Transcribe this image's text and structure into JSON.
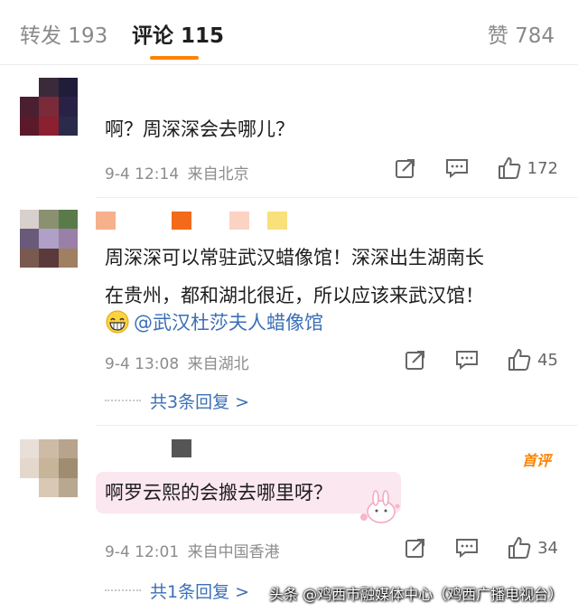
{
  "tabs": {
    "repost": "转发 193",
    "comment": "评论 115",
    "like": "赞 784"
  },
  "comments": [
    {
      "text": "啊？周深深会去哪儿？",
      "time": "9-4 12:14",
      "location": "来自北京",
      "likes": "172"
    },
    {
      "line1": "周深深可以常驻武汉蜡像馆！深深出生湖南长",
      "line2": "在贵州，都和湖北很近，所以应该来武汉馆！",
      "mention": "@武汉杜莎夫人蜡像馆",
      "time": "9-4 13:08",
      "location": "来自湖北",
      "likes": "45",
      "replies": "共3条回复 >"
    },
    {
      "text": "啊罗云熙的会搬去哪里呀？",
      "badge": "首评",
      "time": "9-4 12:01",
      "location": "来自中国香港",
      "likes": "34",
      "replies": "共1条回复 >"
    }
  ],
  "watermark": "头条 @鸡西市融媒体中心（鸡西广播电视台）",
  "colors": {
    "accent": "#ff8200",
    "link": "#3b6fb6",
    "meta": "#8c8c8c"
  }
}
